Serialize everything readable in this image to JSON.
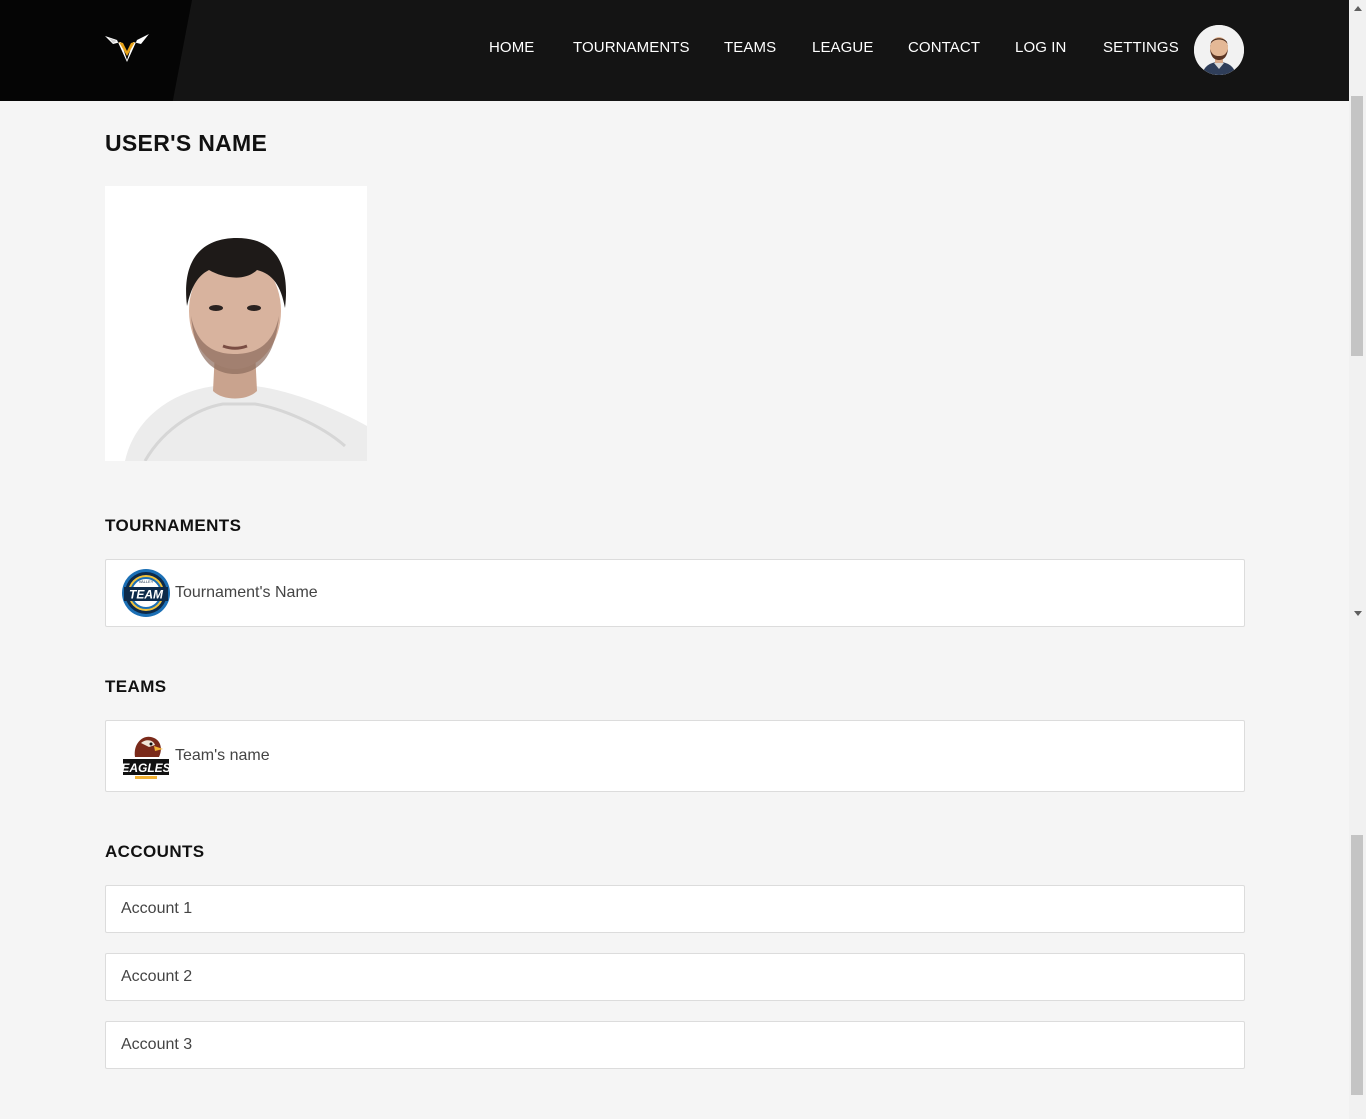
{
  "header": {
    "logo_icon": "v-wings-logo",
    "nav": [
      {
        "label": "HOME"
      },
      {
        "label": "TOURNAMENTS"
      },
      {
        "label": "TEAMS"
      },
      {
        "label": "LEAGUE"
      },
      {
        "label": "CONTACT"
      },
      {
        "label": "LOG IN"
      },
      {
        "label": "SETTINGS"
      }
    ],
    "avatar_icon": "user-avatar"
  },
  "profile": {
    "title": "USER'S NAME",
    "photo_icon": "profile-photo"
  },
  "tournaments": {
    "heading": "TOURNAMENTS",
    "items": [
      {
        "name": "Tournament's Name",
        "badge_text": "TEAM",
        "badge_small": "VALLEY"
      }
    ]
  },
  "teams": {
    "heading": "TEAMS",
    "items": [
      {
        "name": "Team's name",
        "badge_text": "EAGLES"
      }
    ]
  },
  "accounts": {
    "heading": "ACCOUNTS",
    "items": [
      {
        "label": "Account 1"
      },
      {
        "label": "Account 2"
      },
      {
        "label": "Account 3"
      }
    ]
  },
  "colors": {
    "header_bg": "#141414",
    "page_bg": "#f5f5f5",
    "logo_gold": "#e8a317"
  }
}
